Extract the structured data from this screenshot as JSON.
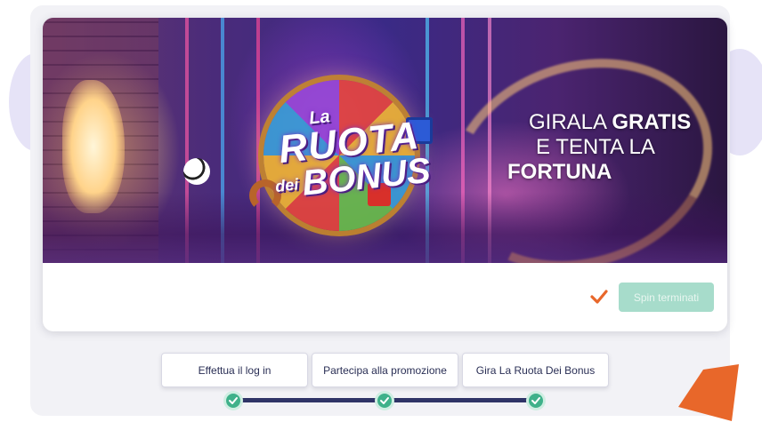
{
  "banner": {
    "logo": {
      "la": "La",
      "ruota": "RUOTA",
      "dei": "dei",
      "bonus": "BONUS"
    },
    "tagline": {
      "line1_prefix": "GIRALA ",
      "line1_strong": "GRATIS",
      "line2": "E TENTA LA",
      "line3": "FORTUNA"
    }
  },
  "action": {
    "status_icon": "check-icon",
    "spin_button_label": "Spin terminati"
  },
  "steps": [
    {
      "label": "Effettua il log in",
      "done": true
    },
    {
      "label": "Partecipa alla promozione",
      "done": true
    },
    {
      "label": "Gira La Ruota Dei Bonus",
      "done": true
    }
  ],
  "colors": {
    "accent_orange": "#e8672a",
    "step_done_green": "#3fb18a",
    "progress_navy": "#2f3467",
    "disabled_button": "#a7dccb"
  }
}
